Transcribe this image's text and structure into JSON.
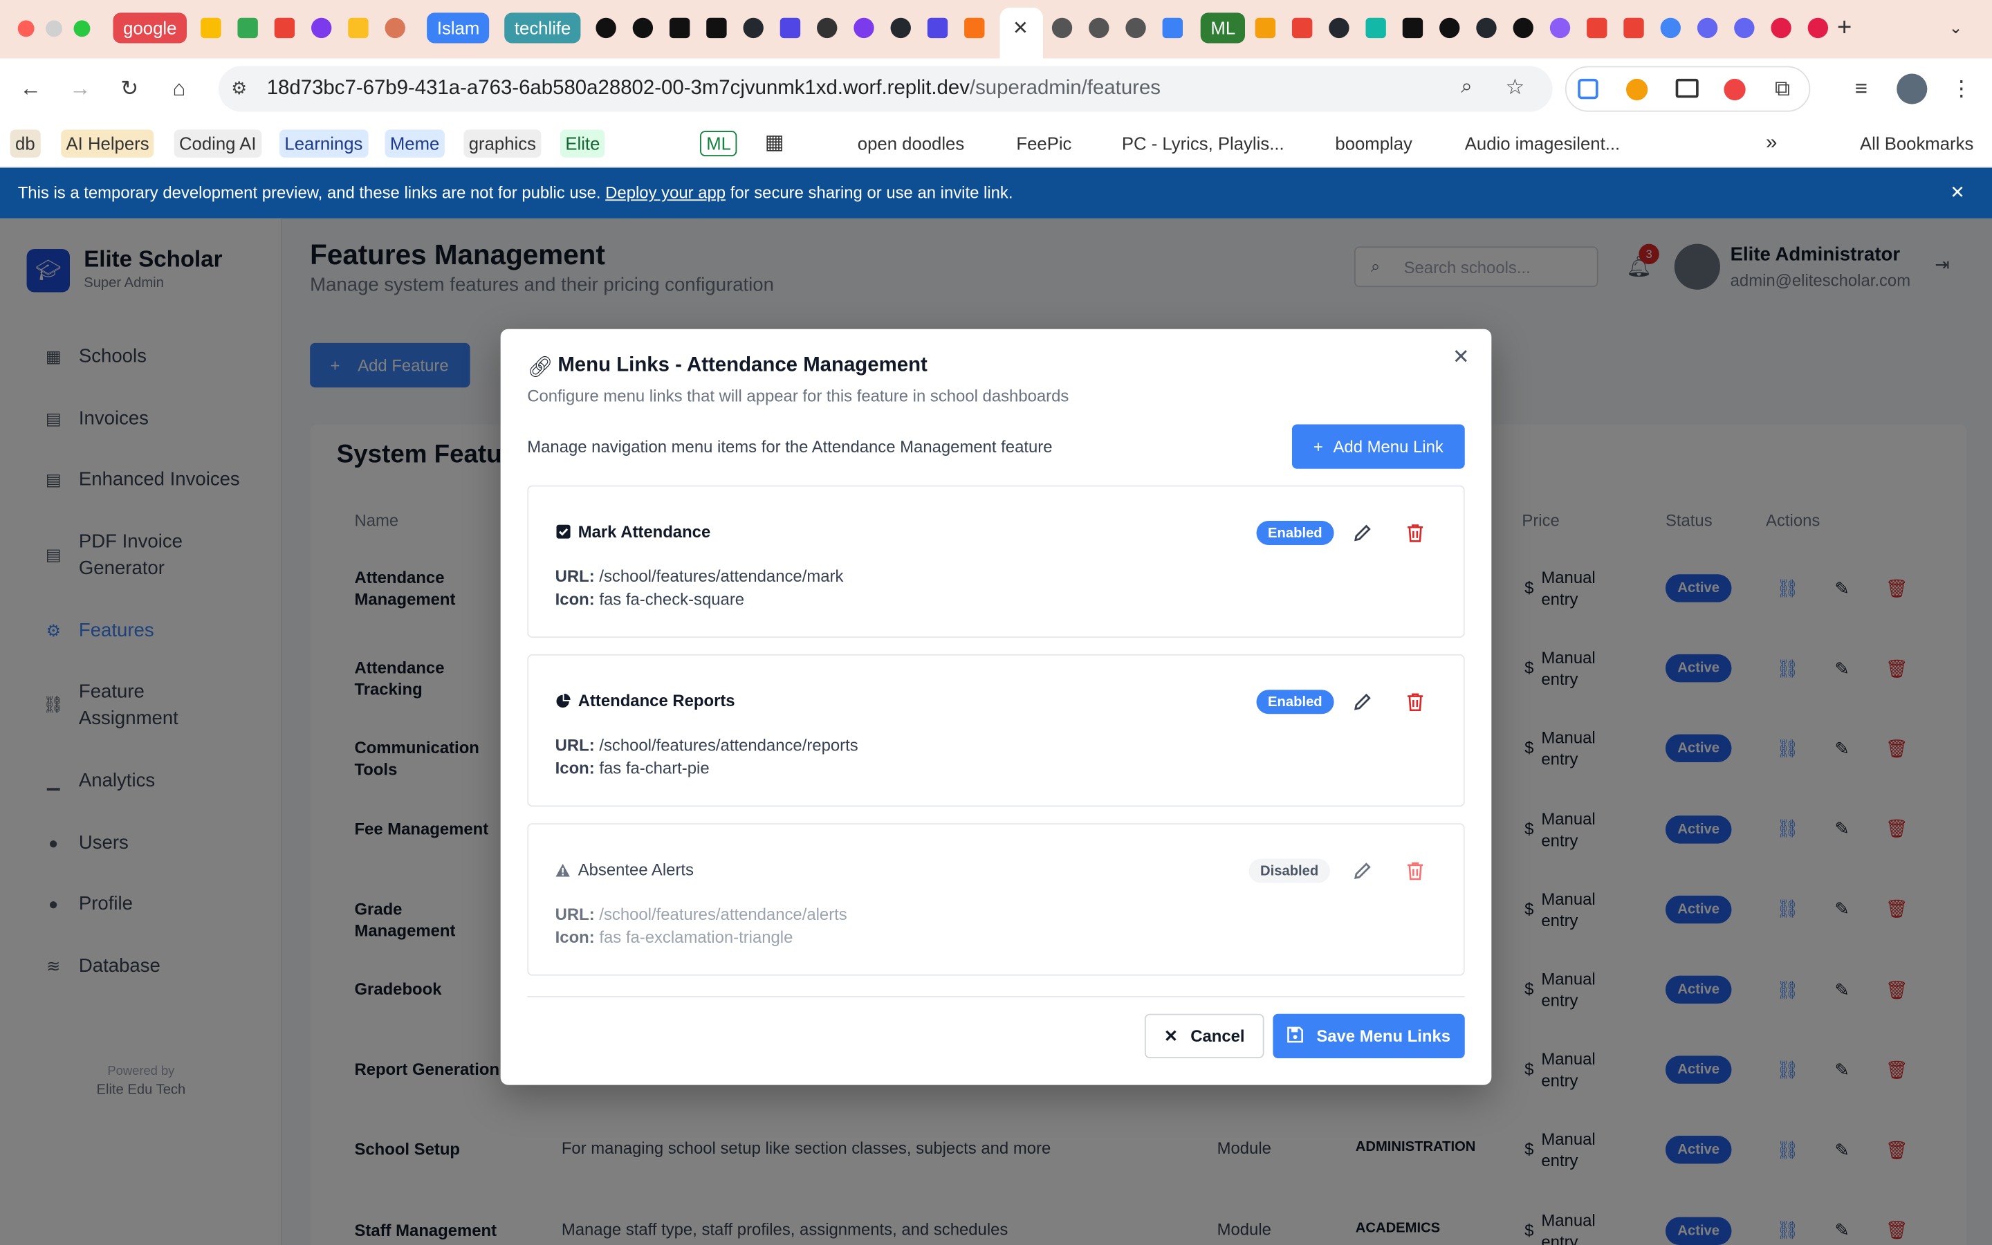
{
  "browser": {
    "tabs": [
      {
        "label": "google",
        "color": "#e5484d"
      },
      {
        "label": "Islam",
        "color": "#3b82f6"
      },
      {
        "label": "techlife",
        "color": "#3b9aa6"
      },
      {
        "label": "ML",
        "color": "#2e7d32"
      }
    ],
    "url_host": "18d73bc7-67b9-431a-a763-6ab580a28802-00-3m7cjvunmk1xd.worf.replit.dev",
    "url_path": "/superadmin/features",
    "bookmarks": [
      "db",
      "AI Helpers",
      "Coding AI",
      "Learnings",
      "Meme",
      "graphics",
      "Elite",
      "ML",
      "open doodles",
      "FeePic",
      "PC - Lyrics, Playlis...",
      "boomplay",
      "Audio imagesilent..."
    ],
    "all_bookmarks": "All Bookmarks"
  },
  "banner": {
    "text_before": "This is a temporary development preview, and these links are not for public use.",
    "link": "Deploy your app",
    "text_after": "for secure sharing or use an invite link."
  },
  "app": {
    "brand": "Elite Scholar",
    "brand_sub": "Super Admin",
    "nav": [
      "Schools",
      "Invoices",
      "Enhanced Invoices",
      "PDF Invoice Generator",
      "Features",
      "Feature Assignment",
      "Analytics",
      "Users",
      "Profile",
      "Database"
    ],
    "footer_line1": "Powered by",
    "footer_line2": "Elite Edu Tech",
    "page_title": "Features Management",
    "page_subtitle": "Manage system features and their pricing configuration",
    "search_placeholder": "Search schools...",
    "notifications": "3",
    "user_name": "Elite Administrator",
    "user_email": "admin@elitescholar.com",
    "add_feature": "Add Feature",
    "section_title": "System Features",
    "columns": [
      "Name",
      "Price",
      "Status",
      "Actions"
    ],
    "rows": [
      {
        "name": "Attendance Management",
        "desc": "",
        "type": "",
        "category": ""
      },
      {
        "name": "Attendance Tracking",
        "desc": "",
        "type": "",
        "category": ""
      },
      {
        "name": "Communication Tools",
        "desc": "",
        "type": "",
        "category": ""
      },
      {
        "name": "Fee Management",
        "desc": "",
        "type": "",
        "category": ""
      },
      {
        "name": "Grade Management",
        "desc": "",
        "type": "",
        "category": ""
      },
      {
        "name": "Gradebook",
        "desc": "",
        "type": "",
        "category": ""
      },
      {
        "name": "Report Generation",
        "desc": "",
        "type": "",
        "category": ""
      },
      {
        "name": "School Setup",
        "desc": "For managing school setup like section classes, subjects and more",
        "type": "Module",
        "category": "ADMINISTRATION"
      },
      {
        "name": "Staff Management",
        "desc": "Manage staff type, staff profiles, assignments, and schedules",
        "type": "Module",
        "category": "ACADEMICS"
      }
    ],
    "price_symbol": "$",
    "price_text": "Manual entry",
    "status_text": "Active"
  },
  "modal": {
    "title": "Menu Links - Attendance Management",
    "subtitle": "Configure menu links that will appear for this feature in school dashboards",
    "description": "Manage navigation menu items for the Attendance Management feature",
    "add_button": "Add Menu Link",
    "url_label": "URL:",
    "icon_label": "Icon:",
    "links": [
      {
        "label": "Mark Attendance",
        "url": "/school/features/attendance/mark",
        "icon": "fas fa-check-square",
        "status": "Enabled",
        "icon_name": "check-square-icon"
      },
      {
        "label": "Attendance Reports",
        "url": "/school/features/attendance/reports",
        "icon": "fas fa-chart-pie",
        "status": "Enabled",
        "icon_name": "chart-pie-icon"
      },
      {
        "label": "Absentee Alerts",
        "url": "/school/features/attendance/alerts",
        "icon": "fas fa-exclamation-triangle",
        "status": "Disabled",
        "icon_name": "exclamation-triangle-icon"
      }
    ],
    "cancel": "Cancel",
    "save": "Save Menu Links"
  },
  "colors": {
    "primary": "#3b82f6",
    "danger": "#dc2626",
    "banner": "#0e4f94",
    "tabstrip": "#f7e3da"
  }
}
